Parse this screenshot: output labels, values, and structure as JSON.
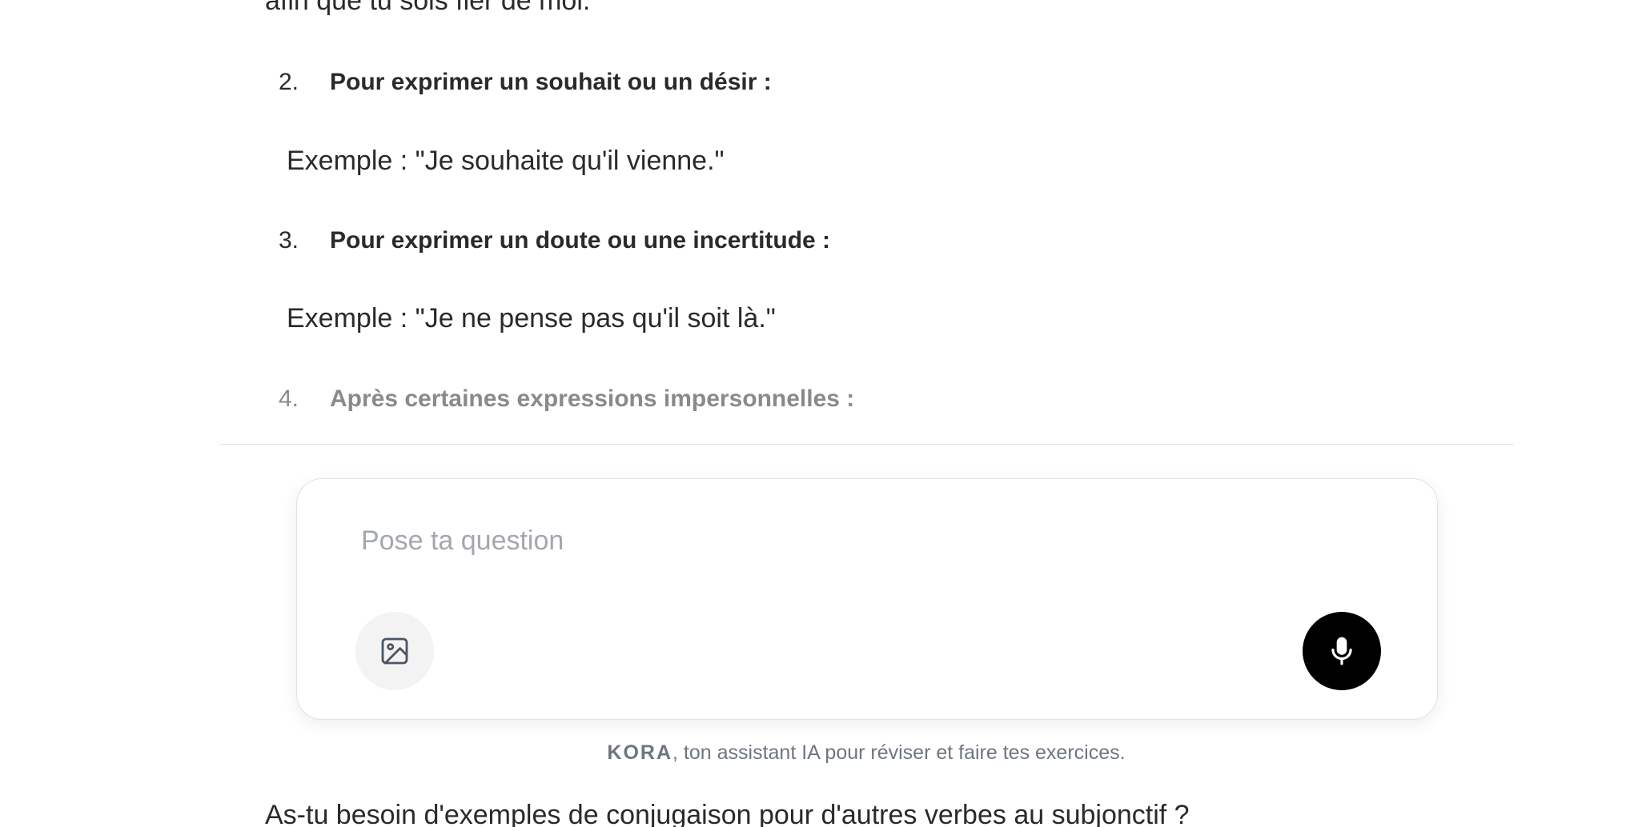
{
  "conversation": {
    "previous_line": "afin que tu sois fier de moi.\"",
    "items": [
      {
        "number": "2.",
        "heading": "Pour exprimer un souhait ou un désir :",
        "example": "Exemple : \"Je souhaite qu'il vienne.\""
      },
      {
        "number": "3.",
        "heading": "Pour exprimer un doute ou une incertitude :",
        "example": "Exemple : \"Je ne pense pas qu'il soit là.\""
      },
      {
        "number": "4.",
        "heading": "Après certaines expressions impersonnelles :"
      }
    ],
    "followup_question": "As-tu besoin d'exemples de conjugaison pour d'autres verbes au subjonctif ?"
  },
  "composer": {
    "placeholder": "Pose ta question",
    "value": "",
    "image_button_icon": "image-icon",
    "mic_button_icon": "microphone-icon"
  },
  "footer": {
    "brand": "KORA",
    "tagline": ", ton assistant IA pour réviser et faire tes exercices."
  },
  "colors": {
    "text": "#2a2a2a",
    "faded_text": "#8a8a8a",
    "placeholder": "#a3a7ae",
    "mic_button": "#000000",
    "image_button_bg": "#f3f3f3",
    "tagline": "#6e7582"
  }
}
